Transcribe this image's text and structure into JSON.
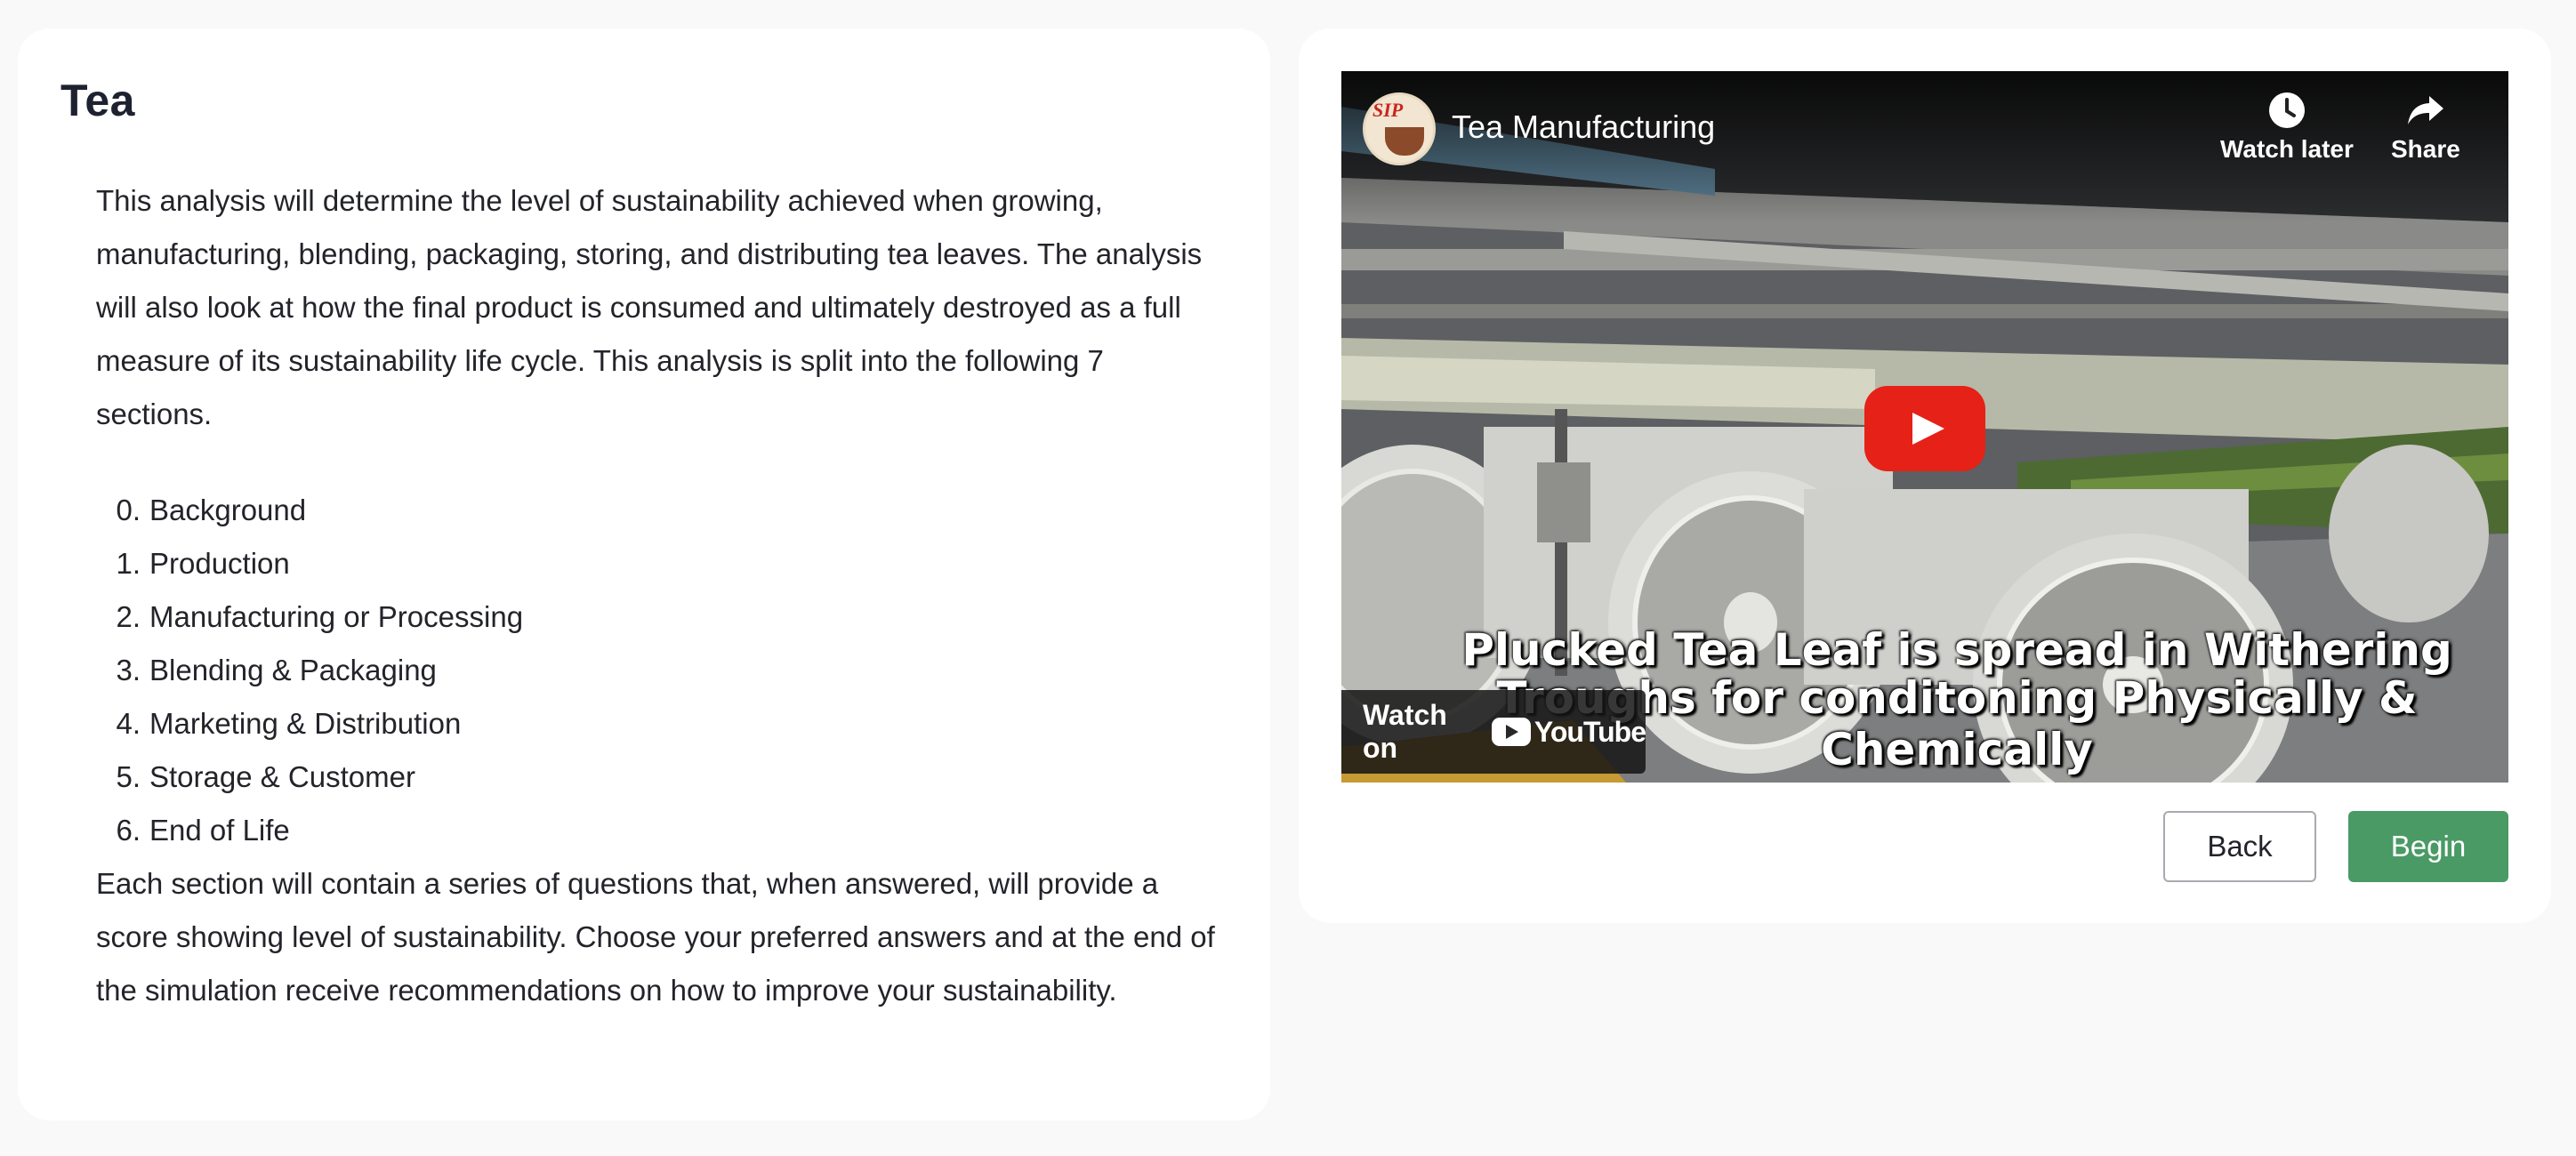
{
  "page": {
    "title": "Tea",
    "intro": "This analysis will determine the level of sustainability achieved when growing, manufacturing, blending, packaging, storing, and distributing tea leaves. The analysis will also look at how the final product is consumed and ultimately destroyed as a full measure of its sustainability life cycle. This analysis is split into the following 7 sections.",
    "sections": [
      {
        "num": "0.",
        "label": "Background"
      },
      {
        "num": "1.",
        "label": "Production"
      },
      {
        "num": "2.",
        "label": "Manufacturing or Processing"
      },
      {
        "num": "3.",
        "label": "Blending & Packaging"
      },
      {
        "num": "4.",
        "label": "Marketing & Distribution"
      },
      {
        "num": "5.",
        "label": "Storage & Customer"
      },
      {
        "num": "6.",
        "label": "End of Life"
      }
    ],
    "outro": "Each section will contain a series of questions that, when answered, will provide a score showing level of sustainability. Choose your preferred answers and at the end of the simulation receive recommendations on how to improve your sustainability."
  },
  "video": {
    "title": "Tea Manufacturing",
    "channel_logo_text": "SIP",
    "watch_later_label": "Watch later",
    "share_label": "Share",
    "caption_line1": "Plucked Tea Leaf is spread in Withering",
    "caption_line2": "Troughs for conditoning Physically & Chemically",
    "watch_on_label": "Watch on",
    "youtube_wordmark": "YouTube",
    "play_color": "#e62117"
  },
  "actions": {
    "back_label": "Back",
    "begin_label": "Begin",
    "begin_color": "#4a9a66"
  }
}
